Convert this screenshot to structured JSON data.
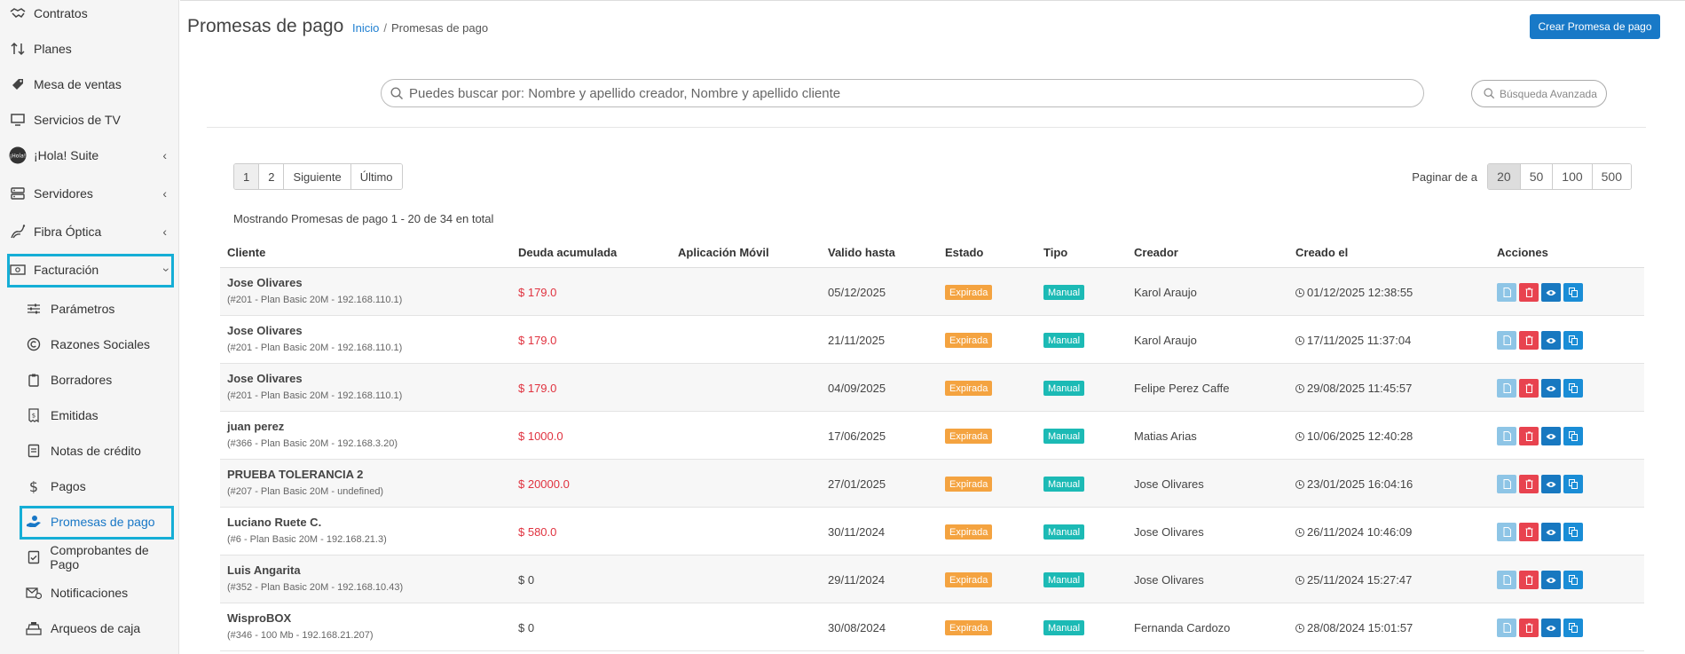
{
  "sidebar": {
    "items": [
      {
        "label": "Contratos",
        "icon": "handshake-icon",
        "has_submenu": false
      },
      {
        "label": "Planes",
        "icon": "sort-arrows-icon",
        "has_submenu": false
      },
      {
        "label": "Mesa de ventas",
        "icon": "tag-icon",
        "has_submenu": false
      },
      {
        "label": "Servicios de TV",
        "icon": "monitor-icon",
        "has_submenu": false
      },
      {
        "label": "¡Hola! Suite",
        "icon": "hola-logo-icon",
        "has_submenu": true
      },
      {
        "label": "Servidores",
        "icon": "server-icon",
        "has_submenu": true
      },
      {
        "label": "Fibra Óptica",
        "icon": "fiber-icon",
        "has_submenu": true
      },
      {
        "label": "Facturación",
        "icon": "bill-icon",
        "has_submenu": true,
        "expanded": true
      }
    ],
    "sub_items": [
      {
        "label": "Parámetros",
        "icon": "sliders-icon"
      },
      {
        "label": "Razones Sociales",
        "icon": "copyright-icon"
      },
      {
        "label": "Borradores",
        "icon": "clipboard-icon"
      },
      {
        "label": "Emitidas",
        "icon": "receipt-icon"
      },
      {
        "label": "Notas de crédito",
        "icon": "note-icon"
      },
      {
        "label": "Pagos",
        "icon": "dollar-icon"
      },
      {
        "label": "Promesas de pago",
        "icon": "hand-coin-icon",
        "active": true
      },
      {
        "label": "Comprobantes de Pago",
        "icon": "doc-check-icon"
      },
      {
        "label": "Notificaciones",
        "icon": "mail-bell-icon"
      },
      {
        "label": "Arqueos de caja",
        "icon": "cash-register-icon"
      }
    ]
  },
  "header": {
    "title": "Promesas de pago",
    "breadcrumb_home": "Inicio",
    "breadcrumb_sep": "/",
    "breadcrumb_current": "Promesas de pago",
    "create_button": "Crear Promesa de pago"
  },
  "search": {
    "placeholder": "Puedes buscar por: Nombre y apellido creador, Nombre y apellido cliente",
    "advanced_label": "Búsqueda Avanzada"
  },
  "pagination": {
    "pages": [
      "1",
      "2",
      "Siguiente",
      "Último"
    ],
    "current": "1",
    "per_page_label": "Paginar de a",
    "per_page_options": [
      "20",
      "50",
      "100",
      "500"
    ],
    "per_page_selected": "20"
  },
  "summary": "Mostrando Promesas de pago 1 - 20 de 34 en total",
  "table": {
    "columns": [
      "Cliente",
      "Deuda acumulada",
      "Aplicación Móvil",
      "Valido hasta",
      "Estado",
      "Tipo",
      "Creador",
      "Creado el",
      "Acciones"
    ],
    "rows": [
      {
        "client": "Jose Olivares",
        "detail": "(#201 - Plan Basic 20M - 192.168.110.1)",
        "debt": "$ 179.0",
        "debt_alert": true,
        "app": "",
        "valid_until": "05/12/2025",
        "status": "Expirada",
        "type": "Manual",
        "creator": "Karol Araujo",
        "created": "01/12/2025 12:38:55"
      },
      {
        "client": "Jose Olivares",
        "detail": "(#201 - Plan Basic 20M - 192.168.110.1)",
        "debt": "$ 179.0",
        "debt_alert": true,
        "app": "",
        "valid_until": "21/11/2025",
        "status": "Expirada",
        "type": "Manual",
        "creator": "Karol Araujo",
        "created": "17/11/2025 11:37:04"
      },
      {
        "client": "Jose Olivares",
        "detail": "(#201 - Plan Basic 20M - 192.168.110.1)",
        "debt": "$ 179.0",
        "debt_alert": true,
        "app": "",
        "valid_until": "04/09/2025",
        "status": "Expirada",
        "type": "Manual",
        "creator": "Felipe Perez Caffe",
        "created": "29/08/2025 11:45:57"
      },
      {
        "client": "juan perez",
        "detail": "(#366 - Plan Basic 20M - 192.168.3.20)",
        "debt": "$ 1000.0",
        "debt_alert": true,
        "app": "",
        "valid_until": "17/06/2025",
        "status": "Expirada",
        "type": "Manual",
        "creator": "Matias Arias",
        "created": "10/06/2025 12:40:28"
      },
      {
        "client": "PRUEBA TOLERANCIA 2",
        "detail": "(#207 - Plan Basic 20M - undefined)",
        "debt": "$ 20000.0",
        "debt_alert": true,
        "app": "",
        "valid_until": "27/01/2025",
        "status": "Expirada",
        "type": "Manual",
        "creator": "Jose Olivares",
        "created": "23/01/2025 16:04:16"
      },
      {
        "client": "Luciano Ruete C.",
        "detail": "(#6 - Plan Basic 20M - 192.168.21.3)",
        "debt": "$ 580.0",
        "debt_alert": true,
        "app": "",
        "valid_until": "30/11/2024",
        "status": "Expirada",
        "type": "Manual",
        "creator": "Jose Olivares",
        "created": "26/11/2024 10:46:09"
      },
      {
        "client": "Luis Angarita",
        "detail": "(#352 - Plan Basic 20M - 192.168.10.43)",
        "debt": "$ 0",
        "debt_alert": false,
        "app": "",
        "valid_until": "29/11/2024",
        "status": "Expirada",
        "type": "Manual",
        "creator": "Jose Olivares",
        "created": "25/11/2024 15:27:47"
      },
      {
        "client": "WisproBOX",
        "detail": "(#346 - 100 Mb - 192.168.21.207)",
        "debt": "$ 0",
        "debt_alert": false,
        "app": "",
        "valid_until": "30/08/2024",
        "status": "Expirada",
        "type": "Manual",
        "creator": "Fernanda Cardozo",
        "created": "28/08/2024 15:01:57"
      }
    ]
  },
  "colors": {
    "primary": "#1879c7",
    "highlight_border": "#15aed6",
    "badge_expired": "#f4a340",
    "badge_manual": "#1cbab5",
    "debt_alert": "#e0323f",
    "action_pdf": "#8ec5e6",
    "action_delete": "#e8434f",
    "action_view": "#1878c0",
    "action_copy": "#1a8dd6"
  }
}
